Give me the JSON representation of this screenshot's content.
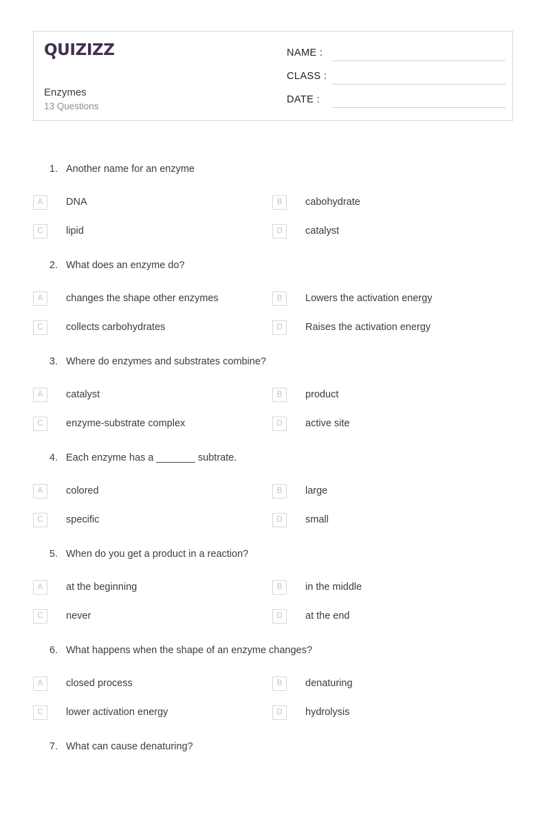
{
  "brand": {
    "logo_text": "QUIZIZZ",
    "logo_color": "#423051"
  },
  "header": {
    "quiz_title": "Enzymes",
    "question_count_label": "13 Questions",
    "fields": [
      {
        "label": "NAME :",
        "value": ""
      },
      {
        "label": "CLASS :",
        "value": ""
      },
      {
        "label": "DATE  :",
        "value": ""
      }
    ]
  },
  "questions": [
    {
      "number": "1.",
      "text": "Another name for an enzyme",
      "options": [
        {
          "letter": "A",
          "text": "DNA"
        },
        {
          "letter": "B",
          "text": "cabohydrate"
        },
        {
          "letter": "C",
          "text": "lipid"
        },
        {
          "letter": "D",
          "text": "catalyst"
        }
      ]
    },
    {
      "number": "2.",
      "text": "What does an enzyme do?",
      "options": [
        {
          "letter": "A",
          "text": "changes the shape other enzymes"
        },
        {
          "letter": "B",
          "text": "Lowers the activation energy"
        },
        {
          "letter": "C",
          "text": "collects carbohydrates"
        },
        {
          "letter": "D",
          "text": "Raises the activation energy"
        }
      ]
    },
    {
      "number": "3.",
      "text": "Where do enzymes and substrates combine?",
      "options": [
        {
          "letter": "A",
          "text": "catalyst"
        },
        {
          "letter": "B",
          "text": "product"
        },
        {
          "letter": "C",
          "text": "enzyme-substrate complex"
        },
        {
          "letter": "D",
          "text": "active site"
        }
      ]
    },
    {
      "number": "4.",
      "text": "Each enzyme has a _______ subtrate.",
      "options": [
        {
          "letter": "A",
          "text": "colored"
        },
        {
          "letter": "B",
          "text": "large"
        },
        {
          "letter": "C",
          "text": "specific"
        },
        {
          "letter": "D",
          "text": "small"
        }
      ]
    },
    {
      "number": "5.",
      "text": "When do you get a product in a reaction?",
      "options": [
        {
          "letter": "A",
          "text": "at the beginning"
        },
        {
          "letter": "B",
          "text": "in the middle"
        },
        {
          "letter": "C",
          "text": "never"
        },
        {
          "letter": "D",
          "text": "at the end"
        }
      ]
    },
    {
      "number": "6.",
      "text": "What happens when the shape of an enzyme changes?",
      "options": [
        {
          "letter": "A",
          "text": "closed process"
        },
        {
          "letter": "B",
          "text": "denaturing"
        },
        {
          "letter": "C",
          "text": "lower activation energy"
        },
        {
          "letter": "D",
          "text": "hydrolysis"
        }
      ]
    },
    {
      "number": "7.",
      "text": "What can cause denaturing?",
      "options": []
    }
  ]
}
